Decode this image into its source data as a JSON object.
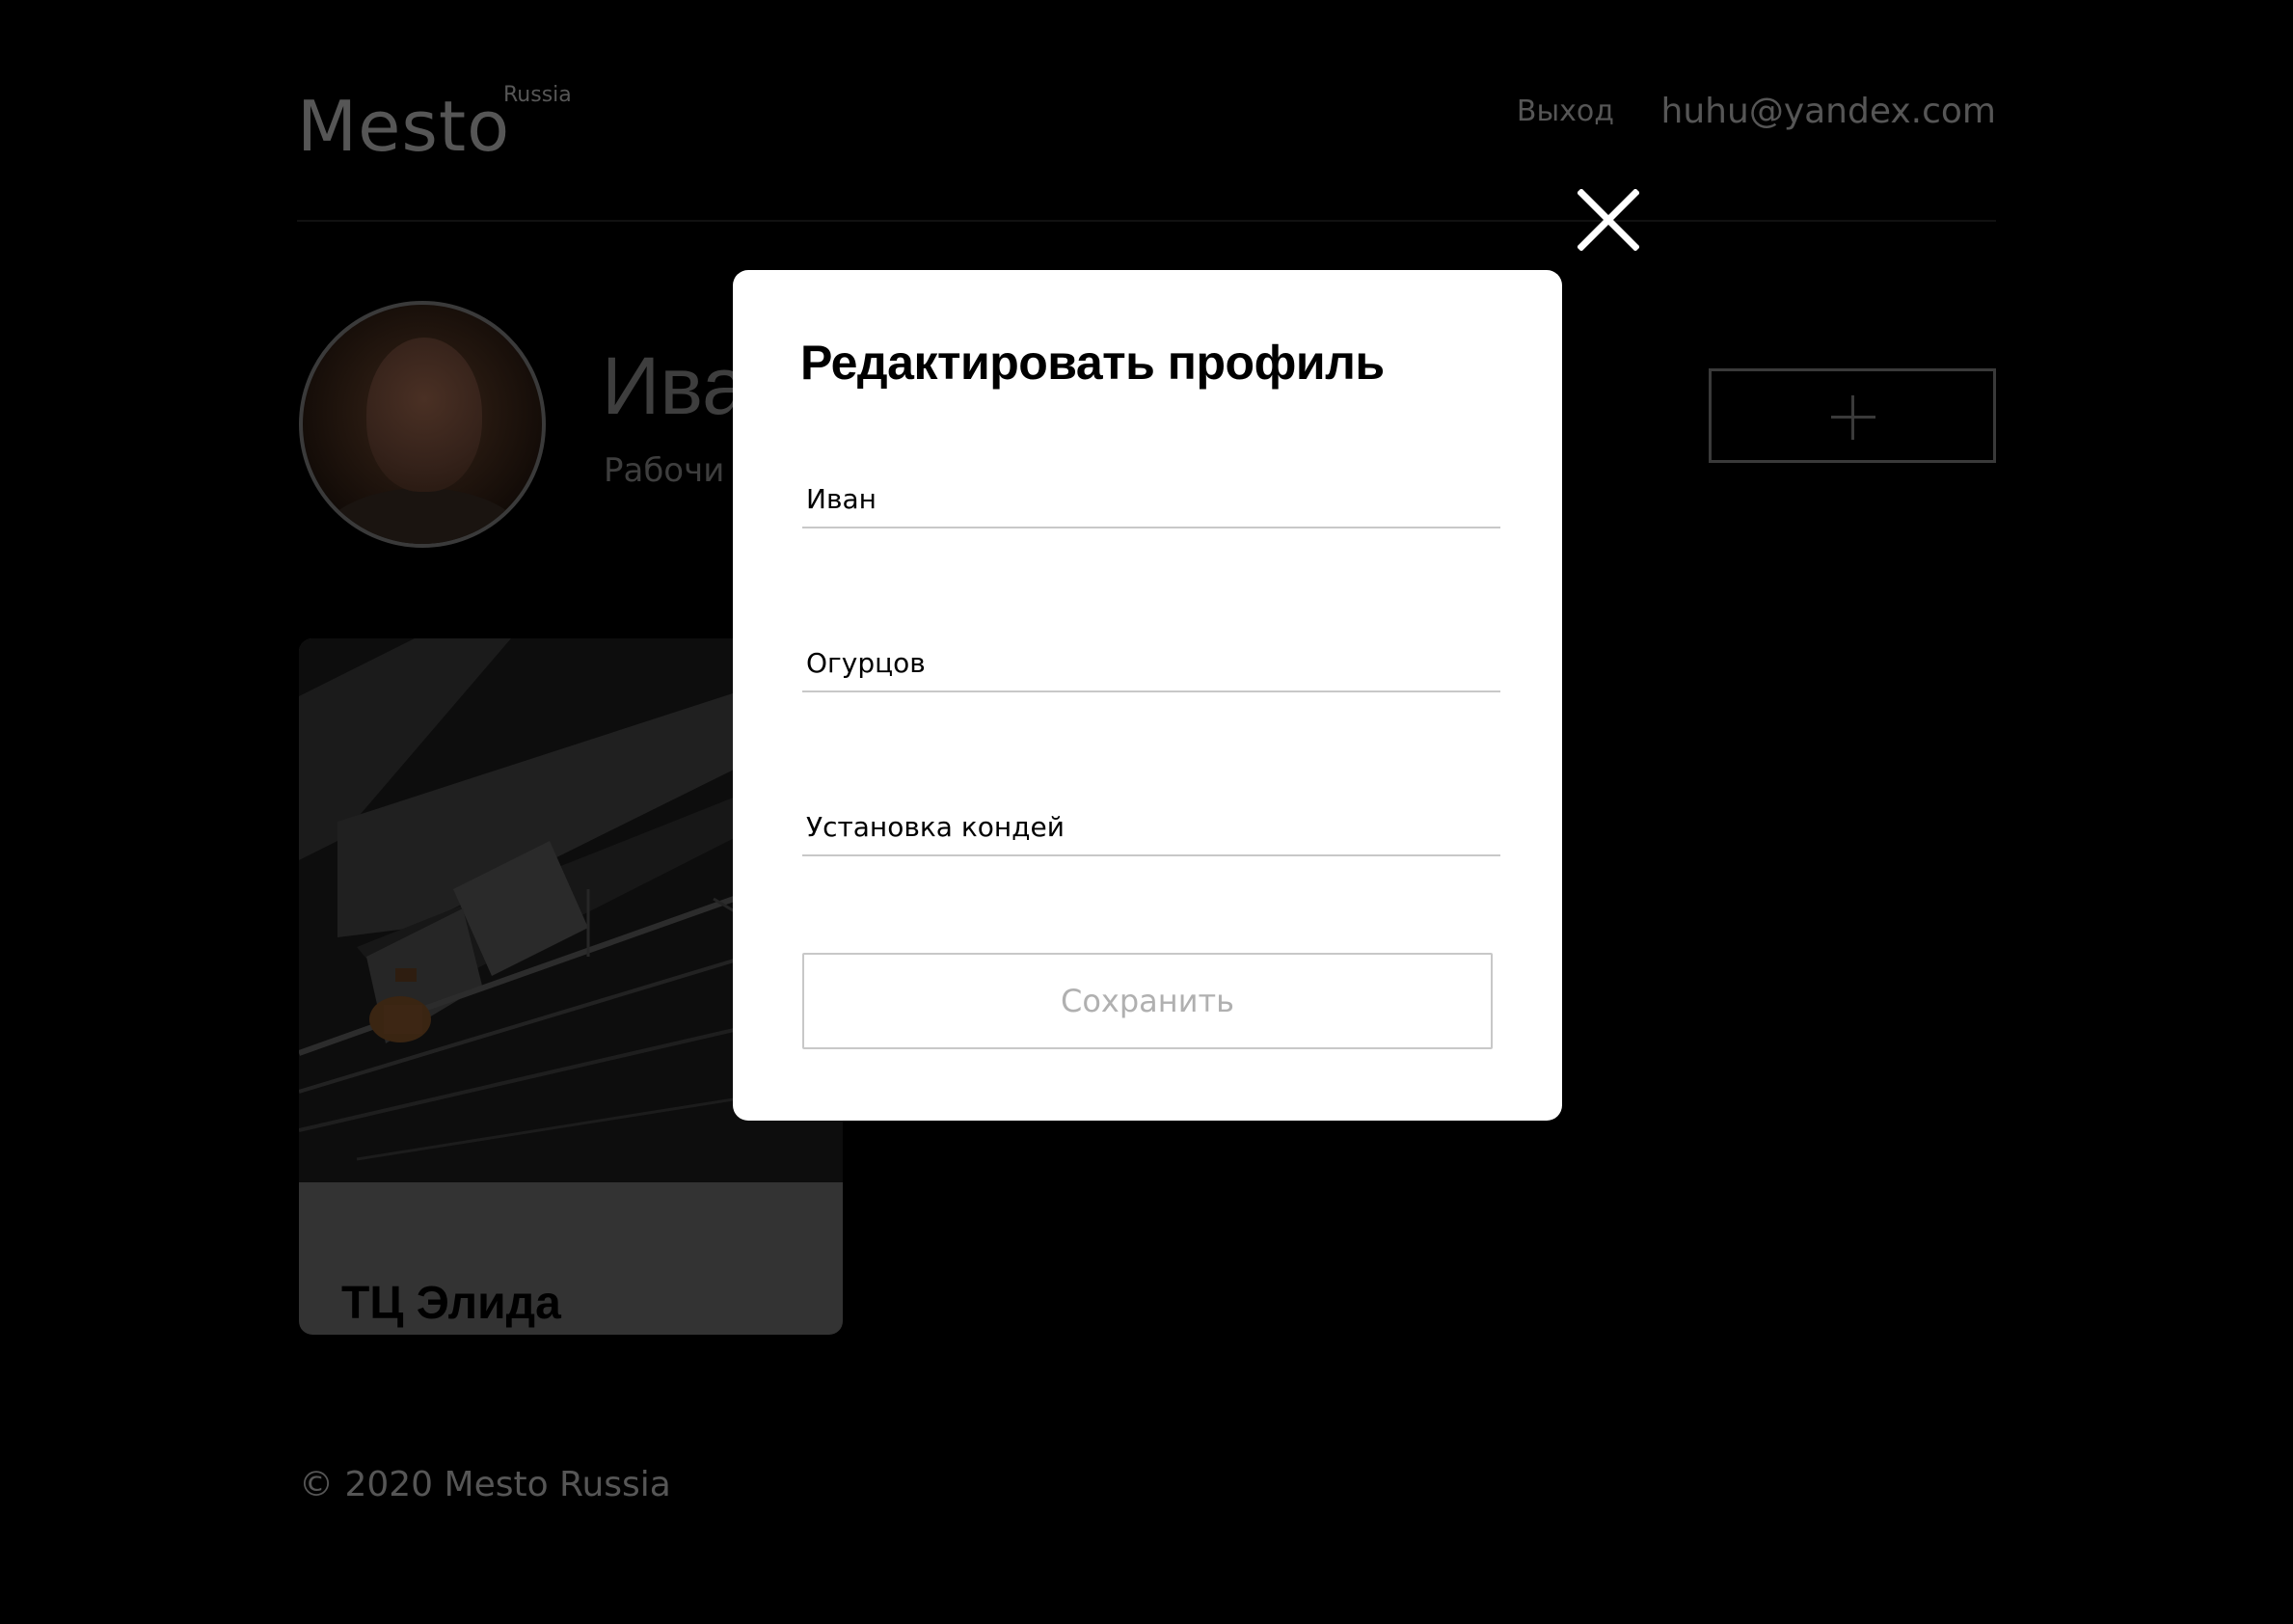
{
  "header": {
    "logo": "Mesto",
    "logo_sup": "Russia",
    "logout_label": "Выход",
    "user_email": "huhu@yandex.com"
  },
  "profile": {
    "name_visible": "Ива",
    "about_visible": "Рабочи",
    "add_button_icon": "plus-icon"
  },
  "cards": [
    {
      "title": "ТЦ Элида"
    }
  ],
  "footer": {
    "copyright": "© 2020 Mesto Russia"
  },
  "popup": {
    "close_icon": "close-icon",
    "title": "Редактировать профиль",
    "fields": {
      "name": "Иван",
      "surname": "Огурцов",
      "about": "Установка кондей"
    },
    "save_label": "Сохранить"
  },
  "colors": {
    "overlay_background": "#000000",
    "popup_background": "#ffffff",
    "dimmed_text": "#565656",
    "button_border": "#c8c8c8",
    "button_text": "#b0b0b0"
  }
}
